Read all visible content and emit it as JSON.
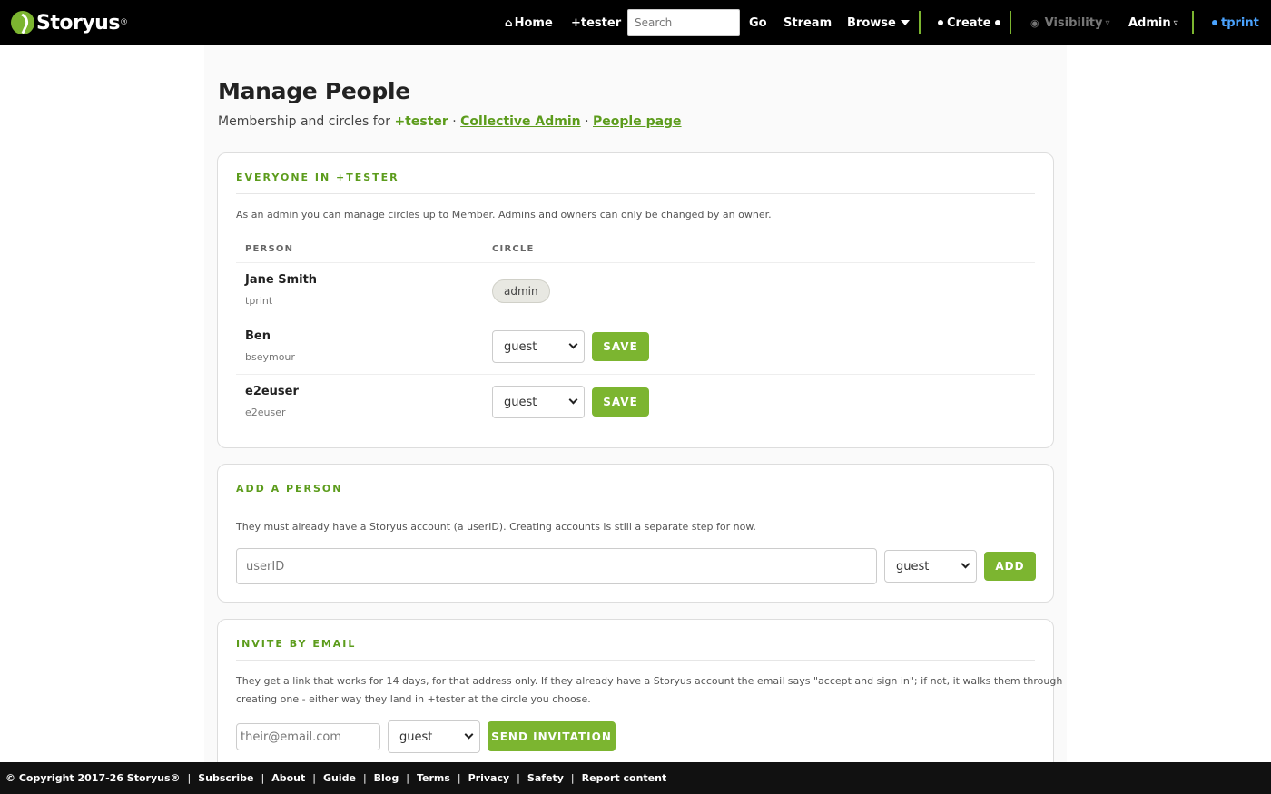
{
  "header": {
    "logo_text": "Storyus",
    "logo_reg": "®",
    "home": "Home",
    "tester": "+tester",
    "search_placeholder": "Search",
    "go": "Go",
    "stream": "Stream",
    "browse": "Browse",
    "create": "Create",
    "visibility": "Visibility",
    "admin": "Admin",
    "user": "tprint",
    "accent": "#7cb530",
    "user_color": "#4aa3ff"
  },
  "page": {
    "title": "Manage People",
    "subtitle_prefix": "Membership and circles for ",
    "subtitle_group": "+tester",
    "sep": " · ",
    "link_admin": "Collective Admin",
    "link_people": "People page"
  },
  "everyone": {
    "heading": "EVERYONE IN +TESTER",
    "desc": "As an admin you can manage circles up to Member. Admins and owners can only be changed by an owner.",
    "col_person": "PERSON",
    "col_circle": "CIRCLE",
    "rows": [
      {
        "name": "Jane Smith",
        "username": "tprint",
        "badge": "admin"
      },
      {
        "name": "Ben",
        "username": "bseymour",
        "circle": "guest",
        "save": "SAVE"
      },
      {
        "name": "e2euser",
        "username": "e2euser",
        "circle": "guest",
        "save": "SAVE"
      }
    ]
  },
  "add_person": {
    "heading": "ADD A PERSON",
    "desc": "They must already have a Storyus account (a userID). Creating accounts is still a separate step for now.",
    "placeholder": "userID",
    "circle": "guest",
    "button": "ADD"
  },
  "invite": {
    "heading": "INVITE BY EMAIL",
    "desc_line1": "They get a link that works for 14 days, for that address only. If they already have a Storyus account the email says \"accept and sign in\"; if not, it walks them through",
    "desc_line2": "creating one - either way they land in +tester at the circle you choose.",
    "placeholder": "their@email.com",
    "circle": "guest",
    "button": "SEND INVITATION"
  },
  "footer": {
    "copyright": "© Copyright 2017-26 Storyus®",
    "links": [
      "Subscribe",
      "About",
      "Guide",
      "Blog",
      "Terms",
      "Privacy",
      "Safety",
      "Report content"
    ]
  }
}
